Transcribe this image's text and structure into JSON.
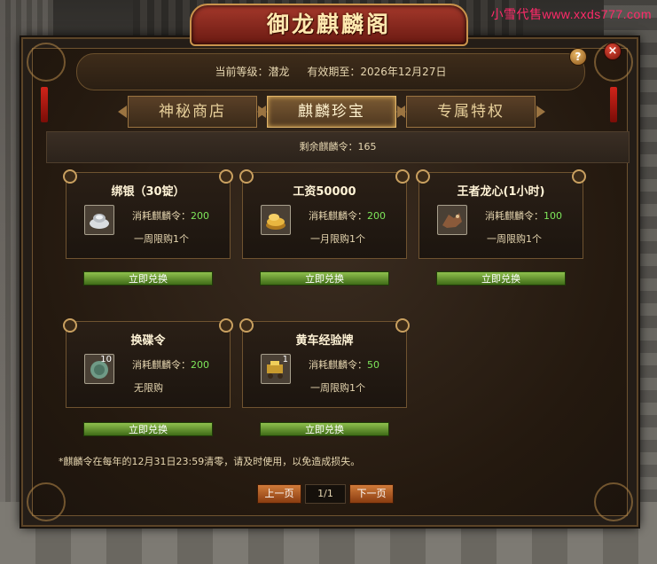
{
  "watermark": "小雪代售www.xxds777.com",
  "title": "御龙麒麟阁",
  "info": {
    "level_label": "当前等级：潜龙",
    "expiry_label": "有效期至：2026年12月27日"
  },
  "help_label": "?",
  "close_label": "×",
  "tabs": [
    {
      "label": "神秘商店",
      "active": false
    },
    {
      "label": "麒麟珍宝",
      "active": true
    },
    {
      "label": "专属特权",
      "active": false
    }
  ],
  "remain_label": "剩余麒麟令：165",
  "items": [
    {
      "name": "绑银（30锭）",
      "cost_label": "消耗麒麟令：",
      "cost": "200",
      "limit": "一周限购1个",
      "icon": "silver-ingot-icon",
      "button": "立即兑换"
    },
    {
      "name": "工资50000",
      "cost_label": "消耗麒麟令：",
      "cost": "200",
      "limit": "一月限购1个",
      "icon": "gold-coins-icon",
      "button": "立即兑换"
    },
    {
      "name": "王者龙心(1小时)",
      "cost_label": "消耗麒麟令：",
      "cost": "100",
      "limit": "一周限购1个",
      "icon": "dragon-heart-icon",
      "button": "立即兑换"
    },
    {
      "name": "换碟令",
      "cost_label": "消耗麒麟令：",
      "cost": "200",
      "limit": "无限购",
      "icon": "exchange-token-icon",
      "badge": "10",
      "button": "立即兑换"
    },
    {
      "name": "黄车经验牌",
      "cost_label": "消耗麒麟令：",
      "cost": "50",
      "limit": "一周限购1个",
      "icon": "yellow-cart-icon",
      "badge": "1",
      "button": "立即兑换"
    }
  ],
  "note": "*麒麟令在每年的12月31日23:59清零，请及时使用，以免造成损失。",
  "pager": {
    "prev": "上一页",
    "page": "1/1",
    "next": "下一页"
  },
  "colors": {
    "accent_green": "#7de65a",
    "button_green": "#8fc04e",
    "gold": "#c9934c"
  }
}
